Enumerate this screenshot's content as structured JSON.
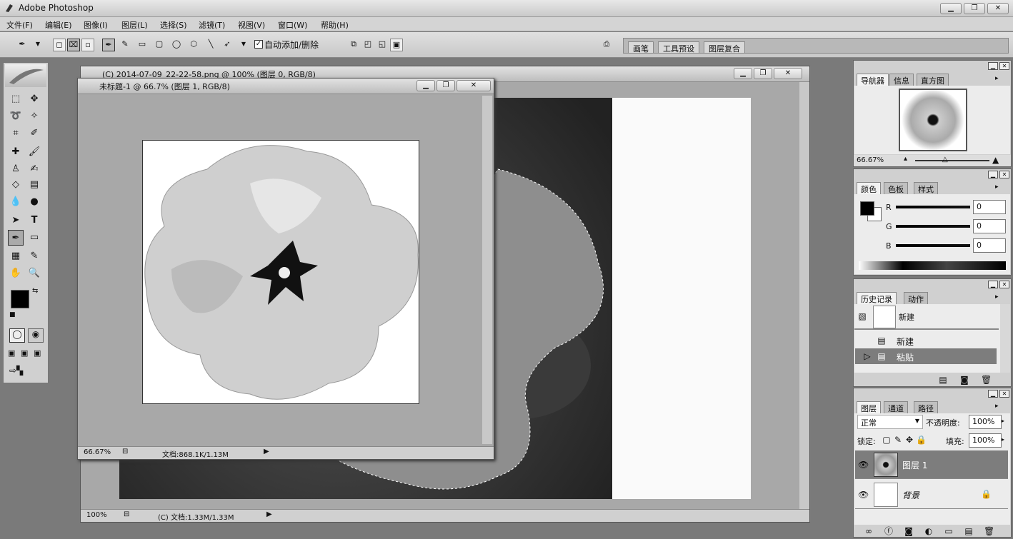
{
  "app": {
    "title": "Adobe Photoshop"
  },
  "menu": [
    "文件(F)",
    "编辑(E)",
    "图像(I)",
    "图层(L)",
    "选择(S)",
    "滤镜(T)",
    "视图(V)",
    "窗口(W)",
    "帮助(H)"
  ],
  "options": {
    "auto_add_label": "自动添加/删除",
    "auto_add_checked": true
  },
  "well_tabs": [
    "画笔",
    "工具预设",
    "图层复合"
  ],
  "doc_back": {
    "title": "(C) 2014-07-09_22-22-58.png @ 100% (图层 0, RGB/8)",
    "zoom": "100%",
    "info": "(C) 文档:1.33M/1.33M"
  },
  "doc_front": {
    "title": "未标题-1 @ 66.7% (图层 1, RGB/8)",
    "zoom": "66.67%",
    "info": "文档:868.1K/1.13M"
  },
  "navigator": {
    "tabs": [
      "导航器",
      "信息",
      "直方图"
    ],
    "zoom": "66.67%"
  },
  "color": {
    "tabs": [
      "颜色",
      "色板",
      "样式"
    ],
    "channels": [
      {
        "label": "R",
        "value": "0"
      },
      {
        "label": "G",
        "value": "0"
      },
      {
        "label": "B",
        "value": "0"
      }
    ]
  },
  "history": {
    "tabs": [
      "历史记录",
      "动作"
    ],
    "snapshot": "新建",
    "items": [
      "新建",
      "粘贴"
    ],
    "selected_index": 1
  },
  "layers": {
    "tabs": [
      "图层",
      "通道",
      "路径"
    ],
    "blend_mode": "正常",
    "opacity_label": "不透明度:",
    "opacity": "100%",
    "lock_label": "锁定:",
    "fill_label": "填充:",
    "fill": "100%",
    "items": [
      {
        "name": "图层 1",
        "selected": true
      },
      {
        "name": "背景",
        "selected": false
      }
    ]
  }
}
